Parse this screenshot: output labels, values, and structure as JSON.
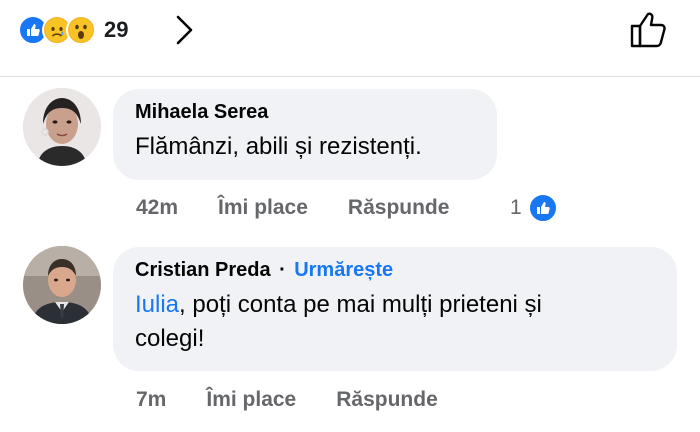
{
  "reactions_bar": {
    "count": "29",
    "icons": [
      "like-icon",
      "sad-icon",
      "wow-icon"
    ]
  },
  "colors": {
    "accent": "#1877f2",
    "bubble": "#f0f2f5",
    "meta": "#65676b"
  },
  "comments": [
    {
      "author": "Mihaela Serea",
      "text": "Flămânzi, abili și rezistenți.",
      "time": "42m",
      "like_label": "Îmi place",
      "reply_label": "Răspunde",
      "reaction_count": "1"
    },
    {
      "author": "Cristian Preda",
      "follow_label": "Urmărește",
      "separator": "·",
      "mention": "Iulia",
      "text_line1": ", poți conta pe mai mulți prieteni și",
      "text_line2": "colegi!",
      "time": "7m",
      "like_label": "Îmi place",
      "reply_label": "Răspunde"
    }
  ]
}
